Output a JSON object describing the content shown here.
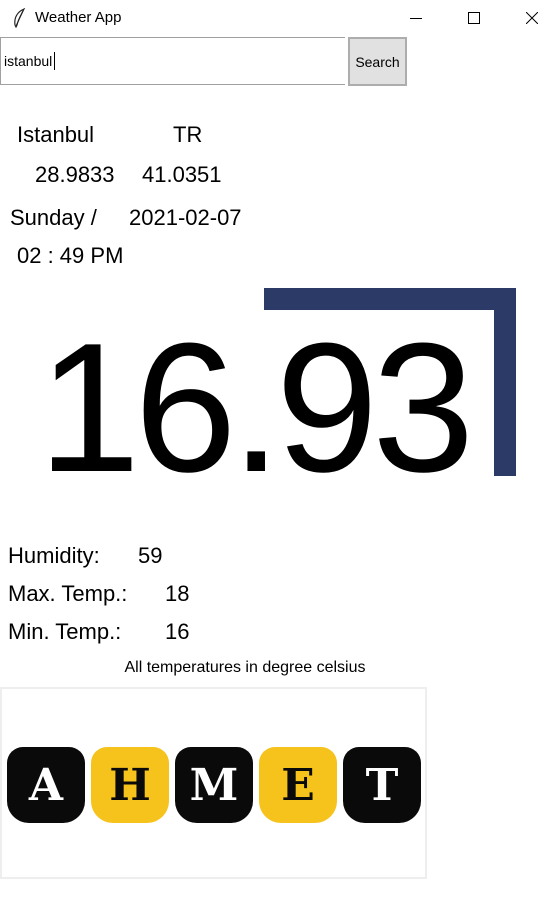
{
  "window": {
    "title": "Weather App",
    "icons": {
      "app": "feather-icon",
      "minimize": "minimize-icon",
      "maximize": "maximize-icon",
      "close": "close-icon"
    }
  },
  "search": {
    "value": "istanbul",
    "button_label": "Search"
  },
  "location": {
    "city": "Istanbul",
    "country": "TR",
    "longitude": "28.9833",
    "latitude": "41.0351"
  },
  "datetime": {
    "weekday": "Sunday /",
    "date": "2021-02-07",
    "time": "02 : 49 PM"
  },
  "current": {
    "temperature": "16.93"
  },
  "details": {
    "humidity_label": "Humidity:",
    "humidity_value": "59",
    "max_label": "Max. Temp.:",
    "max_value": "18",
    "min_label": "Min. Temp.:",
    "min_value": "16"
  },
  "note": "All temperatures in degree celsius",
  "logo": {
    "letters": [
      "A",
      "H",
      "M",
      "E",
      "T"
    ],
    "colors": {
      "black": "#0a0a0a",
      "yellow": "#f6c21c"
    }
  },
  "colors": {
    "accent_frame": "#2b3a67",
    "search_button": "#e1e1e1"
  }
}
